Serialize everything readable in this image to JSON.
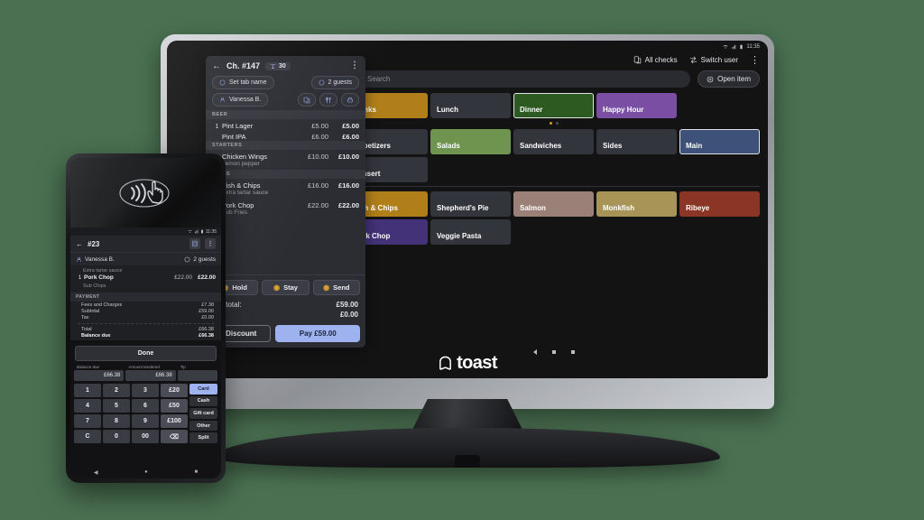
{
  "background_color": "#4a7051",
  "terminal": {
    "brand": "toast",
    "status_bar": {
      "time": "11:35",
      "icons": [
        "wifi-icon",
        "signal-icon",
        "battery-icon"
      ]
    },
    "topbar": {
      "all_checks": "All checks",
      "switch_user": "Switch user",
      "overflow": "⋮"
    },
    "search": {
      "placeholder": "Search",
      "open_item": "Open item"
    },
    "check": {
      "title": "Ch. #147",
      "table_badge": "30",
      "back": "←",
      "overflow": "⋮",
      "set_tab_name": "Set tab name",
      "guests": "2 guests",
      "server": "Vanessa B.",
      "groups": [
        {
          "name": "BEER",
          "items": [
            {
              "qty": "1",
              "name": "Pint Lager",
              "price": "£5.00",
              "total": "£5.00",
              "modifier": ""
            },
            {
              "qty": "",
              "name": "Pint IPA",
              "price": "£6.00",
              "total": "£6.00",
              "modifier": ""
            }
          ]
        },
        {
          "name": "STARTERS",
          "items": [
            {
              "qty": "",
              "name": "Chicken Wings",
              "price": "£10.00",
              "total": "£10.00",
              "modifier": "Lemon pepper"
            }
          ]
        },
        {
          "name": "MAINS",
          "items": [
            {
              "qty": "",
              "name": "Fish & Chips",
              "price": "£16.00",
              "total": "£16.00",
              "modifier": "Extra tartar sauce"
            },
            {
              "qty": "",
              "name": "Pork Chop",
              "price": "£22.00",
              "total": "£22.00",
              "modifier": "Sub Fries"
            }
          ]
        }
      ],
      "actions": [
        {
          "label": "Hold",
          "icon": "pause-icon"
        },
        {
          "label": "Stay",
          "icon": "clock-icon"
        },
        {
          "label": "Send",
          "icon": "send-icon"
        }
      ],
      "totals": [
        {
          "label": "Subtotal:",
          "value": "£59.00"
        },
        {
          "label": "",
          "value": "£0.00"
        }
      ],
      "discount": "Discount",
      "pay": "Pay £59.00",
      "pay_color": "#9db2ef"
    },
    "menu": {
      "menus": [
        {
          "label": "Drinks",
          "color": "#b07f1a",
          "selected": false
        },
        {
          "label": "Lunch",
          "color": "#33353c",
          "selected": false
        },
        {
          "label": "Dinner",
          "color": "#2d5a21",
          "selected": true
        },
        {
          "label": "Happy Hour",
          "color": "#7a4fa3",
          "selected": false
        }
      ],
      "pager": {
        "pages": 2,
        "active": 0
      },
      "groups": [
        {
          "label": "Appetizers",
          "color": "#33353c",
          "selected": false
        },
        {
          "label": "Salads",
          "color": "#6f9450",
          "selected": false
        },
        {
          "label": "Sandwiches",
          "color": "#33353c",
          "selected": false
        },
        {
          "label": "Sides",
          "color": "#33353c",
          "selected": false
        },
        {
          "label": "Main",
          "color": "#3d5179",
          "selected": true
        },
        {
          "label": "Dessert",
          "color": "#33353c",
          "selected": false
        }
      ],
      "items": [
        {
          "label": "Fish & Chips",
          "color": "#b07f1a"
        },
        {
          "label": "Shepherd's Pie",
          "color": "#33353c"
        },
        {
          "label": "Salmon",
          "color": "#9b8078"
        },
        {
          "label": "Monkfish",
          "color": "#a89457"
        },
        {
          "label": "Ribeye",
          "color": "#8b3526"
        },
        {
          "label": "Pork Chop",
          "color": "#433278"
        },
        {
          "label": "Veggie Pasta",
          "color": "#33353c"
        }
      ]
    },
    "page_dots": {
      "count": 3
    }
  },
  "phone": {
    "nfc_icon": "contactless-payment-icon",
    "status_bar": {
      "time": "11:35"
    },
    "header": {
      "back": "←",
      "title": "#23",
      "calculator_icon": "calculator-icon",
      "overflow": "⋮"
    },
    "guest_row": {
      "server": "Vanessa B.",
      "guests": "2 guests"
    },
    "items": [
      {
        "modifier": "Extra tartar sauce",
        "qty": "1",
        "name": "Pork Chop",
        "price": "£22.00",
        "total": "£22.00",
        "sub": "Sub Chips"
      }
    ],
    "payment_header": "PAYMENT",
    "payment_lines": [
      {
        "label": "Fees and Charges",
        "value": "£7.38"
      },
      {
        "label": "Subtotal",
        "value": "£59.00"
      },
      {
        "label": "Tax",
        "value": "£0.00"
      }
    ],
    "payment_totals": [
      {
        "label": "Total",
        "value": "£66.38",
        "strong": false
      },
      {
        "label": "Balance due",
        "value": "£66.38",
        "strong": true
      }
    ],
    "done": "Done",
    "amount_fields": [
      {
        "label": "Balance due",
        "value": "£66.38"
      },
      {
        "label": "Amount tendered",
        "value": "£66.38"
      },
      {
        "label": "Tip",
        "value": ""
      }
    ],
    "keys": [
      "1",
      "2",
      "3",
      "£20",
      "4",
      "5",
      "6",
      "£50",
      "7",
      "8",
      "9",
      "£100",
      "C",
      "0",
      "00",
      "⌫"
    ],
    "tenders": [
      {
        "label": "Card",
        "highlight": true
      },
      {
        "label": "Cash",
        "highlight": false
      },
      {
        "label": "Gift card",
        "highlight": false
      },
      {
        "label": "Other",
        "highlight": false
      },
      {
        "label": "Split",
        "highlight": false
      }
    ],
    "nav": [
      "◀",
      "●",
      "■"
    ]
  }
}
